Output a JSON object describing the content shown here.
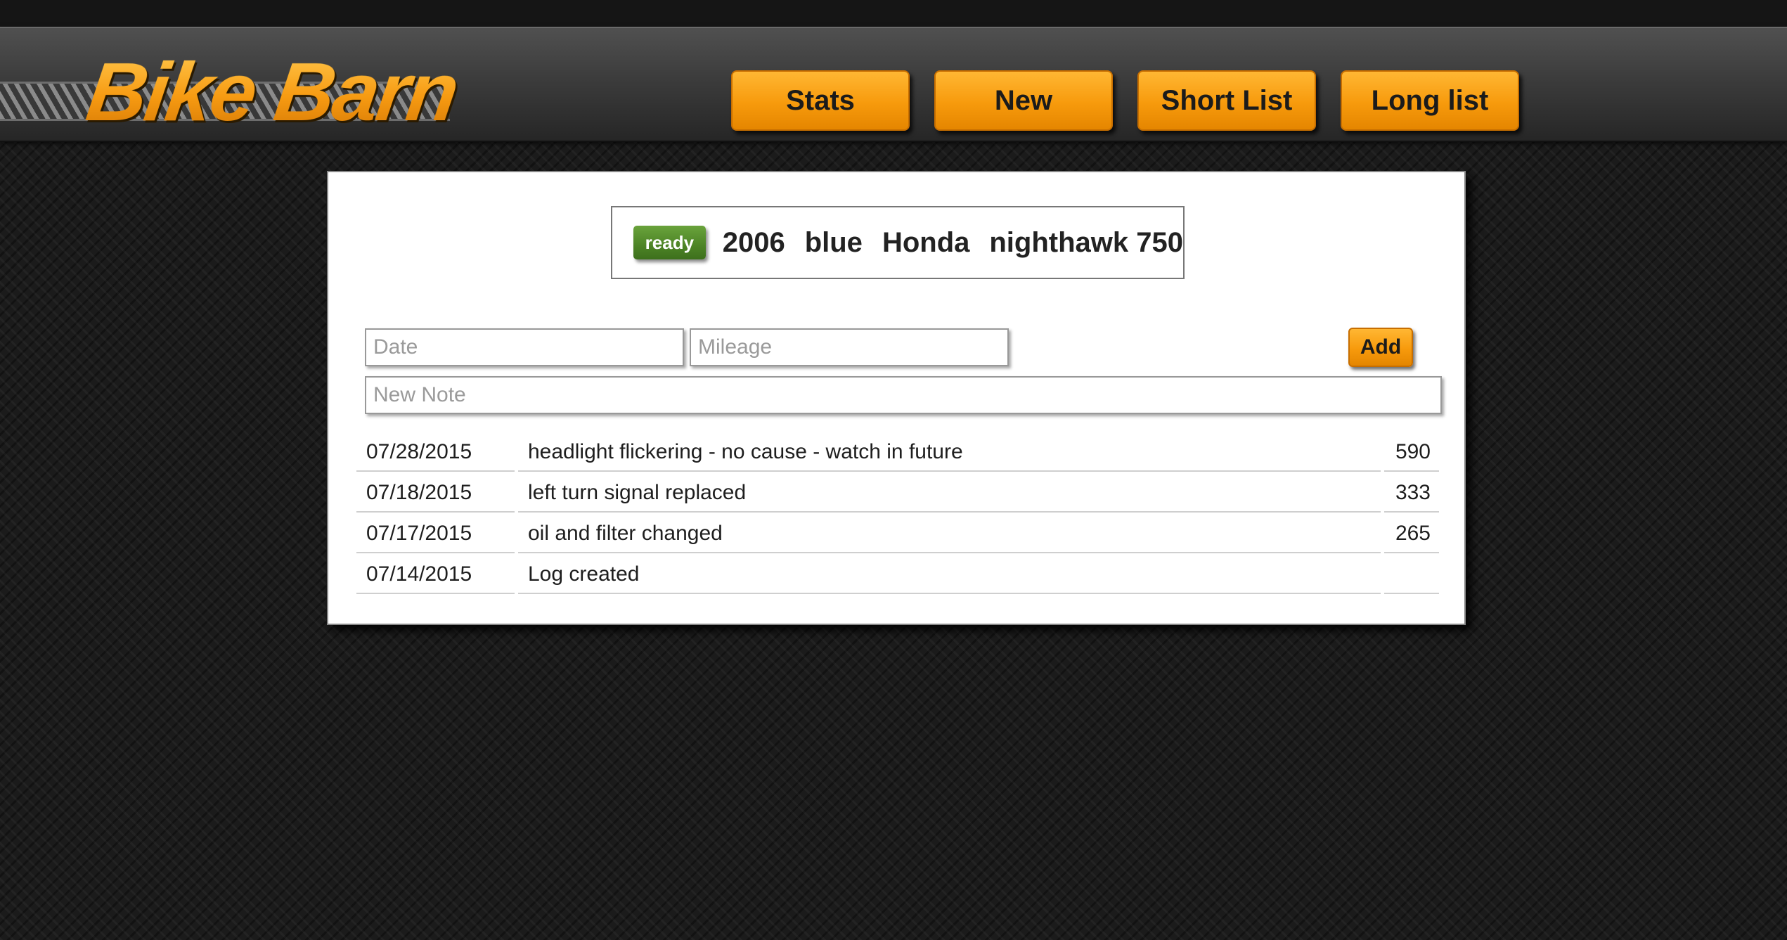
{
  "app": {
    "logo_text": "Bike Barn"
  },
  "nav": {
    "items": [
      {
        "label": "Stats"
      },
      {
        "label": "New"
      },
      {
        "label": "Short List"
      },
      {
        "label": "Long list"
      }
    ]
  },
  "bike": {
    "status": "ready",
    "status_color": "#4d8426",
    "year": "2006",
    "color": "blue",
    "make": "Honda",
    "model": "nighthawk 750"
  },
  "form": {
    "date_placeholder": "Date",
    "mileage_placeholder": "Mileage",
    "note_placeholder": "New Note",
    "add_label": "Add"
  },
  "log": {
    "rows": [
      {
        "date": "07/28/2015",
        "note": "headlight flickering - no cause - watch in future",
        "miles": "590"
      },
      {
        "date": "07/18/2015",
        "note": "left turn signal replaced",
        "miles": "333"
      },
      {
        "date": "07/17/2015",
        "note": "oil and filter changed",
        "miles": "265"
      },
      {
        "date": "07/14/2015",
        "note": "Log created",
        "miles": ""
      }
    ]
  },
  "colors": {
    "accent": "#f79a0c",
    "background": "#1b1b1b"
  }
}
